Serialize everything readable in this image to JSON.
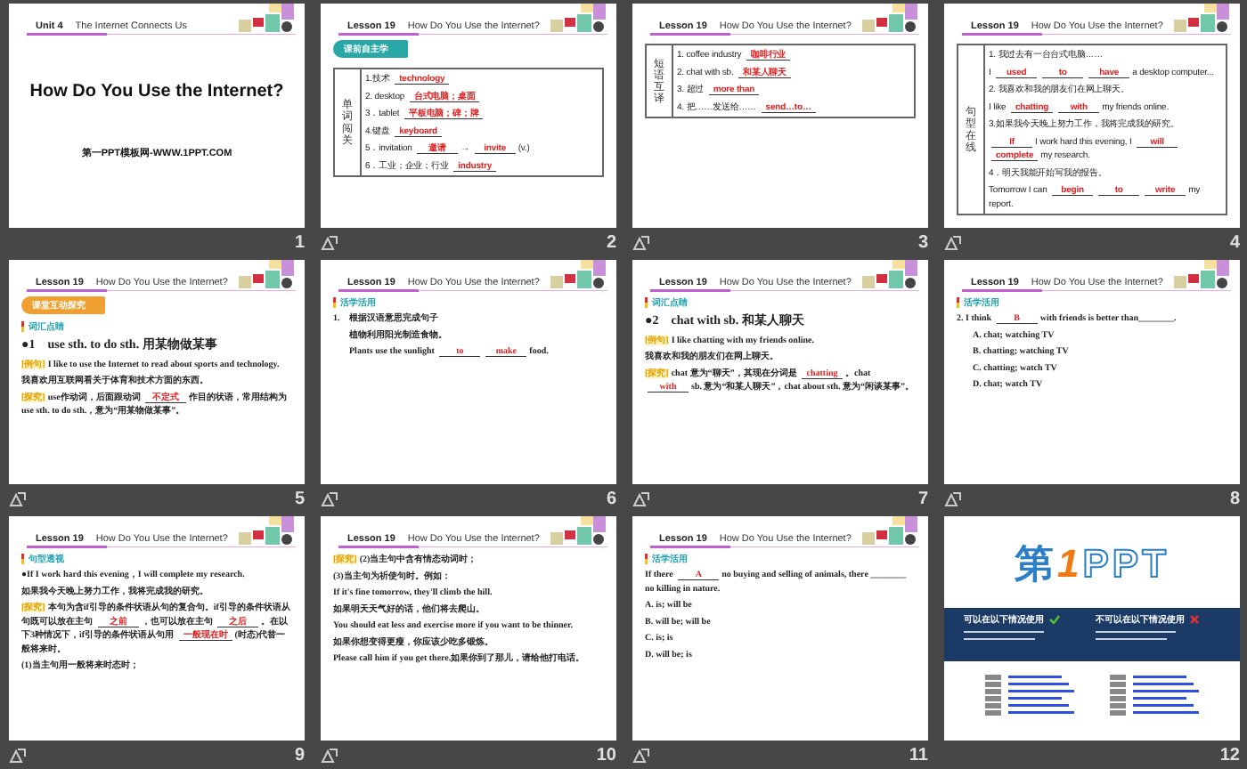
{
  "slides": [
    {
      "number": "1",
      "animated": false,
      "kind": "title",
      "header": {
        "label": "Unit 4",
        "title": "The Internet Connects Us"
      },
      "title": "How Do You Use the Internet?",
      "subtitle": "第一PPT模板网-WWW.1PPT.COM"
    },
    {
      "number": "2",
      "animated": true,
      "kind": "lesson",
      "header": {
        "label": "Lesson 19",
        "title": "How Do You Use the Internet?"
      },
      "blocks": [
        {
          "kind": "banner",
          "text": "课前自主学",
          "color": "#2aa7a7"
        },
        {
          "kind": "table",
          "heading": "单词闯关",
          "rows": [
            {
              "parts": [
                "1.技术",
                {
                  "answer": "technology"
                }
              ]
            },
            {
              "parts": [
                "2. desktop",
                {
                  "answer": "台式电脑；桌面"
                }
              ]
            },
            {
              "parts": [
                "3．tablet",
                {
                  "answer": "平板电脑；碑；牌"
                }
              ]
            },
            {
              "parts": [
                "4.键盘",
                {
                  "answer": "keyboard"
                }
              ]
            },
            {
              "parts": [
                "5．invitation",
                {
                  "answer": "邀请"
                },
                "→",
                {
                  "answer": "invite"
                },
                "(v.)"
              ]
            },
            {
              "parts": [
                "6．工业；企业；行业",
                {
                  "answer": "industry"
                }
              ]
            }
          ]
        }
      ]
    },
    {
      "number": "3",
      "animated": true,
      "kind": "lesson",
      "header": {
        "label": "Lesson 19",
        "title": "How Do You Use the Internet?"
      },
      "blocks": [
        {
          "kind": "table",
          "heading": "短语互译",
          "rows": [
            {
              "parts": [
                "1. coffee industry",
                {
                  "answer": "咖啡行业"
                }
              ]
            },
            {
              "parts": [
                "2. chat with sb.",
                {
                  "answer": "和某人聊天"
                }
              ]
            },
            {
              "parts": [
                "3. 超过",
                {
                  "answer": "more than"
                }
              ]
            },
            {
              "parts": [
                "4. 把……发送给……",
                {
                  "answer": "send…to…"
                }
              ]
            }
          ]
        }
      ]
    },
    {
      "number": "4",
      "animated": true,
      "kind": "lesson",
      "header": {
        "label": "Lesson 19",
        "title": "How Do You Use the Internet?"
      },
      "blocks": [
        {
          "kind": "table",
          "heading": "句型在线",
          "rows": [
            {
              "parts": [
                "1. 我过去有一台台式电脑……"
              ]
            },
            {
              "parts": [
                "I",
                {
                  "answer": "used"
                },
                {
                  "answer": "to"
                },
                {
                  "answer": "have"
                },
                "a desktop computer..."
              ]
            },
            {
              "parts": [
                "2. 我喜欢和我的朋友们在网上聊天。"
              ]
            },
            {
              "parts": [
                "I like",
                {
                  "answer": "chatting"
                },
                {
                  "answer": "with"
                },
                "my friends online."
              ]
            },
            {
              "parts": [
                "3.如果我今天晚上努力工作，我将完成我的研究。"
              ]
            },
            {
              "parts": [
                {
                  "answer": "If"
                },
                "I work hard this evening, I",
                {
                  "answer": "will"
                },
                {
                  "answer": "complete"
                },
                "my research."
              ]
            },
            {
              "parts": [
                "4．明天我能开始写我的报告。"
              ]
            },
            {
              "parts": [
                "Tomorrow I can",
                {
                  "answer": "begin"
                },
                {
                  "answer": "to"
                },
                {
                  "answer": "write"
                },
                "my report."
              ]
            }
          ]
        }
      ]
    },
    {
      "number": "5",
      "animated": true,
      "kind": "lesson",
      "header": {
        "label": "Lesson 19",
        "title": "How Do You Use the Internet?"
      },
      "blocks": [
        {
          "kind": "banner",
          "text": "课堂互动探究",
          "color": "#f0a030"
        },
        {
          "kind": "section",
          "text": "词汇点睛"
        },
        {
          "kind": "point",
          "parts": [
            "●1　use sth. to do sth. 用某物做某事"
          ]
        },
        {
          "kind": "line",
          "parts": [
            {
              "tag": "[例句]"
            },
            "I like to use the Internet to read about sports and technology."
          ]
        },
        {
          "kind": "line",
          "parts": [
            "我喜欢用互联网看关于体育和技术方面的东西。"
          ]
        },
        {
          "kind": "line",
          "parts": [
            {
              "tag": "[探究]"
            },
            "use作动词，后面跟动词",
            {
              "answer": "不定式"
            },
            "作目的状语，常用结构为use sth. to do sth.，意为“用某物做某事”。"
          ]
        }
      ]
    },
    {
      "number": "6",
      "animated": true,
      "kind": "lesson",
      "header": {
        "label": "Lesson 19",
        "title": "How Do You Use the Internet?"
      },
      "blocks": [
        {
          "kind": "section",
          "text": "活学活用"
        },
        {
          "kind": "line",
          "parts": [
            "1.　根据汉语意思完成句子"
          ]
        },
        {
          "kind": "option",
          "parts": [
            "植物利用阳光制造食物。"
          ]
        },
        {
          "kind": "option",
          "parts": [
            "Plants use the sunlight",
            {
              "answer": "to"
            },
            {
              "answer": "make"
            },
            "food."
          ]
        }
      ]
    },
    {
      "number": "7",
      "animated": true,
      "kind": "lesson",
      "header": {
        "label": "Lesson 19",
        "title": "How Do You Use the Internet?"
      },
      "blocks": [
        {
          "kind": "section",
          "text": "词汇点睛"
        },
        {
          "kind": "point",
          "parts": [
            "●2　chat with sb. 和某人聊天"
          ]
        },
        {
          "kind": "line",
          "parts": [
            {
              "tag": "[例句]"
            },
            "I like chatting with my friends online."
          ]
        },
        {
          "kind": "line",
          "parts": [
            "我喜欢和我的朋友们在网上聊天。"
          ]
        },
        {
          "kind": "line",
          "parts": [
            {
              "tag": "[探究]"
            },
            "chat 意为“聊天”，其现在分词是",
            {
              "answer": "chatting"
            },
            "。chat",
            {
              "answer": "with"
            },
            "sb. 意为“和某人聊天”，chat about sth. 意为“闲谈某事”。"
          ]
        }
      ]
    },
    {
      "number": "8",
      "animated": true,
      "kind": "lesson",
      "header": {
        "label": "Lesson 19",
        "title": "How Do You Use the Internet?"
      },
      "blocks": [
        {
          "kind": "section",
          "text": "活学活用"
        },
        {
          "kind": "line",
          "parts": [
            "2. I think",
            {
              "answer": "B"
            },
            "with friends is better than________."
          ]
        },
        {
          "kind": "option",
          "parts": [
            "A. chat; watching TV"
          ]
        },
        {
          "kind": "option",
          "parts": [
            "B. chatting; watching TV"
          ]
        },
        {
          "kind": "option",
          "parts": [
            "C. chatting; watch TV"
          ]
        },
        {
          "kind": "option",
          "parts": [
            "D. chat; watch TV"
          ]
        }
      ]
    },
    {
      "number": "9",
      "animated": true,
      "kind": "lesson",
      "header": {
        "label": "Lesson 19",
        "title": "How Do You Use the Internet?"
      },
      "blocks": [
        {
          "kind": "section",
          "text": "句型透视"
        },
        {
          "kind": "line",
          "parts": [
            "●If I work hard this evening，I will complete my research."
          ]
        },
        {
          "kind": "line",
          "parts": [
            "如果我今天晚上努力工作，我将完成我的研究。"
          ]
        },
        {
          "kind": "line",
          "parts": [
            {
              "tag": "[探究]"
            },
            "本句为含if引导的条件状语从句的复合句。if引导的条件状语从句既可以放在主句",
            {
              "answer": "之前"
            },
            "，也可以放在主句",
            {
              "answer": "之后"
            },
            "。在以下3种情况下，if引导的条件状语从句用",
            {
              "answer": "一般现在时"
            },
            "(时态)代替一般将来时。"
          ]
        },
        {
          "kind": "line",
          "parts": [
            "(1)当主句用一般将来时态时；"
          ]
        }
      ]
    },
    {
      "number": "10",
      "animated": true,
      "kind": "lesson",
      "header": {
        "label": "Lesson 19",
        "title": "How Do You Use the Internet?"
      },
      "blocks": [
        {
          "kind": "line",
          "parts": [
            {
              "tag": "[探究]"
            },
            "(2)当主句中含有情态动词时；"
          ]
        },
        {
          "kind": "line",
          "parts": [
            "(3)当主句为祈使句时。例如："
          ]
        },
        {
          "kind": "line",
          "parts": [
            "If it's fine tomorrow, they'll climb the hill."
          ]
        },
        {
          "kind": "line",
          "parts": [
            "如果明天天气好的话，他们将去爬山。"
          ]
        },
        {
          "kind": "line",
          "parts": [
            "You should eat less and exercise more if you want to be thinner."
          ]
        },
        {
          "kind": "line",
          "parts": [
            "如果你想变得更瘦，你应该少吃多锻炼。"
          ]
        },
        {
          "kind": "line",
          "parts": [
            "Please call him if you get there.如果你到了那儿，请给他打电话。"
          ]
        }
      ]
    },
    {
      "number": "11",
      "animated": true,
      "kind": "lesson",
      "header": {
        "label": "Lesson 19",
        "title": "How Do You Use the Internet?"
      },
      "blocks": [
        {
          "kind": "section",
          "text": "活学活用"
        },
        {
          "kind": "line",
          "parts": [
            "If there",
            {
              "answer": "A"
            },
            "no buying and selling of animals, there ________ no killing in nature."
          ]
        },
        {
          "kind": "line",
          "parts": [
            "A. is; will be"
          ]
        },
        {
          "kind": "line",
          "parts": [
            "B. will be; will be"
          ]
        },
        {
          "kind": "line",
          "parts": [
            "C. is; is"
          ]
        },
        {
          "kind": "line",
          "parts": [
            "D. will be; is"
          ]
        }
      ]
    },
    {
      "number": "12",
      "animated": false,
      "kind": "logo",
      "logo": {
        "word": "第",
        "digit": "1",
        "letters": "PPT"
      },
      "notes": [
        "可以在以下情况使用",
        "不可以在以下情况使用"
      ]
    }
  ]
}
